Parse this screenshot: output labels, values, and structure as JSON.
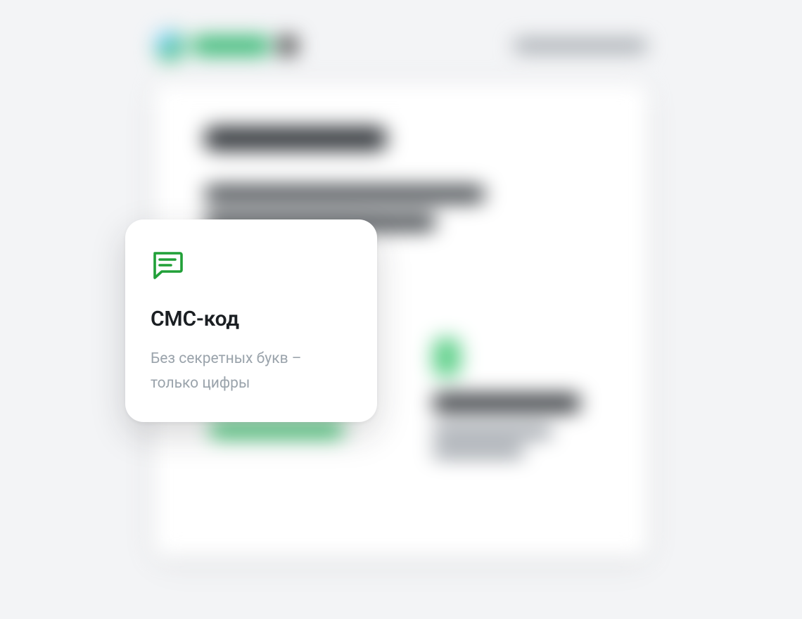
{
  "card": {
    "title": "СМС-код",
    "description": "Без секретных букв – только цифры",
    "icon": "chat-icon"
  }
}
